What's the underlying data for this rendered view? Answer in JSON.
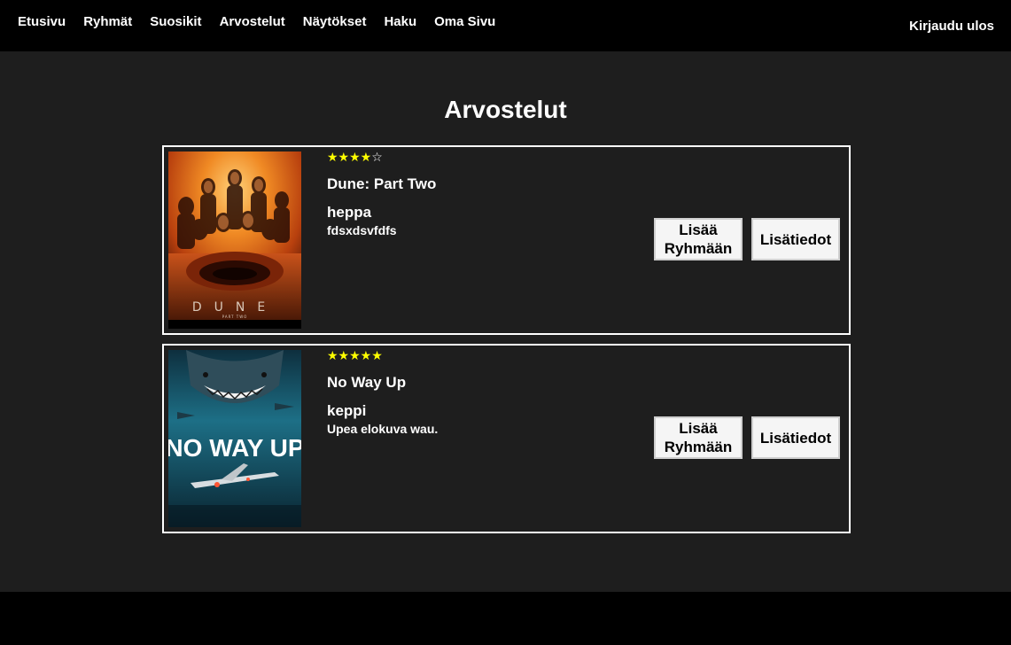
{
  "nav": {
    "links": [
      "Etusivu",
      "Ryhmät",
      "Suosikit",
      "Arvostelut",
      "Näytökset",
      "Haku",
      "Oma Sivu"
    ],
    "logout_label": "Kirjaudu ulos"
  },
  "page": {
    "title": "Arvostelut"
  },
  "reviews": [
    {
      "rating": 4,
      "max_rating": 5,
      "stars_filled": "★★★★",
      "stars_empty": "☆",
      "movie_title": "Dune: Part Two",
      "reviewer": "heppa",
      "text": "fdsxdsvfdfs",
      "poster_text": "DUNE",
      "poster_subtext": "PART TWO",
      "add_group_label": "Lisää Ryhmään",
      "details_label": "Lisätiedot"
    },
    {
      "rating": 5,
      "max_rating": 5,
      "stars_filled": "★★★★★",
      "stars_empty": "",
      "movie_title": "No Way Up",
      "reviewer": "keppi",
      "text": "Upea elokuva wau.",
      "poster_text": "NO WAY UP",
      "add_group_label": "Lisää Ryhmään",
      "details_label": "Lisätiedot"
    }
  ],
  "colors": {
    "background": "#1e1e1e",
    "nav_background": "#000000",
    "star": "#ffff00",
    "button_bg": "#f5f5f5"
  }
}
